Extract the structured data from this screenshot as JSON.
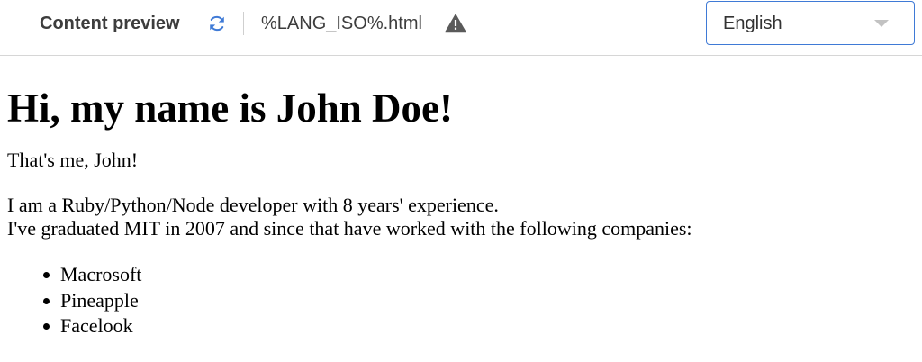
{
  "toolbar": {
    "title": "Content preview",
    "refresh_icon": "refresh-icon",
    "filename": "%LANG_ISO%.html",
    "warning_icon": "warning-icon",
    "language_select": {
      "value": "English"
    }
  },
  "content": {
    "heading": "Hi, my name is John Doe!",
    "intro": "That's me, John!",
    "bio_line1": "I am a Ruby/Python/Node developer with 8 years' experience.",
    "bio_line2_prefix": "I've graduated ",
    "bio_line2_abbr": "MIT",
    "bio_line2_suffix": " in 2007 and since that have worked with the following companies:",
    "companies": [
      "Macrosoft",
      "Pineapple",
      "Facelook"
    ]
  },
  "colors": {
    "accent_border": "#3f7ad6",
    "refresh_icon": "#3f7ad6",
    "warning_icon": "#5a5a5a"
  }
}
